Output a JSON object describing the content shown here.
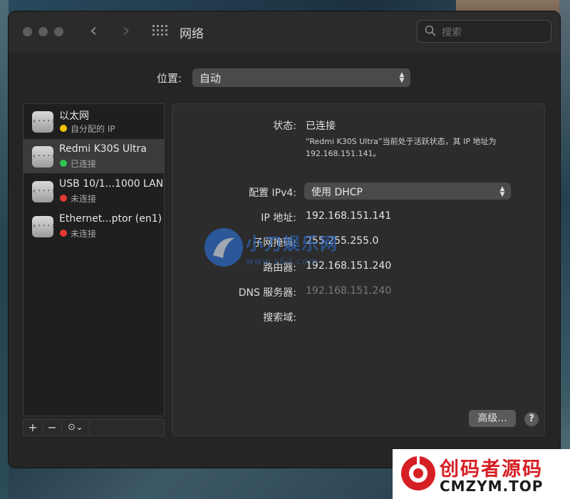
{
  "window": {
    "title": "网络"
  },
  "search": {
    "placeholder": "搜索"
  },
  "location": {
    "label": "位置:",
    "value": "自动"
  },
  "services": [
    {
      "name": "以太网",
      "status": "自分配的 IP",
      "status_color": "#f5c400",
      "icon": "ethernet-icon"
    },
    {
      "name": "Redmi K30S Ultra",
      "status": "已连接",
      "status_color": "#2ec44f",
      "icon": "ethernet-icon"
    },
    {
      "name": "USB 10/1...1000 LAN",
      "status": "未连接",
      "status_color": "#e53935",
      "icon": "ethernet-icon"
    },
    {
      "name": "Ethernet...ptor (en1)",
      "status": "未连接",
      "status_color": "#e53935",
      "icon": "ethernet-icon"
    }
  ],
  "sidebar_buttons": {
    "add": "+",
    "remove": "−",
    "action": "⊙⌄"
  },
  "detail": {
    "status_label": "状态:",
    "status_value": "已连接",
    "status_desc": "“Redmi K30S Ultra”当前处于活跃状态，其 IP 地址为 192.168.151.141。",
    "config_label": "配置 IPv4:",
    "config_value": "使用 DHCP",
    "ip_label": "IP 地址:",
    "ip_value": "192.168.151.141",
    "subnet_label": "子网掩码:",
    "subnet_value": "255.255.255.0",
    "router_label": "路由器:",
    "router_value": "192.168.151.240",
    "dns_label": "DNS 服务器:",
    "dns_value": "192.168.151.240",
    "search_domain_label": "搜索域:",
    "advanced_button": "高级...",
    "help_button": "?"
  },
  "watermark": {
    "text": "小刀娱乐网",
    "url": "www.x6d.com"
  },
  "corner_watermark": {
    "cn": "创码者源码",
    "en": "CMZYM.TOP"
  },
  "colors": {
    "accent_red": "#d61f25",
    "watermark_blue": "#2d6ed2"
  }
}
